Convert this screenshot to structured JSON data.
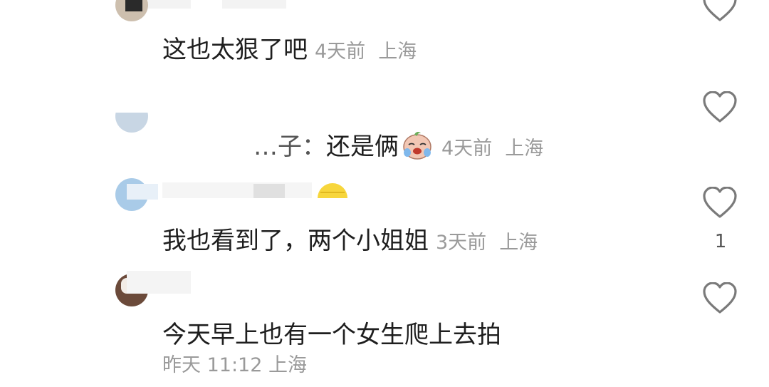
{
  "comments": [
    {
      "text": "这也太狠了吧",
      "time": "4天前",
      "location": "上海",
      "likes": ""
    },
    {
      "reply_prefix": "…子：",
      "text": "还是俩",
      "emoji": "crying-laughing-face-emoji",
      "time": "4天前",
      "location": "上海",
      "likes": ""
    },
    {
      "text": "我也看到了，两个小姐姐",
      "time": "3天前",
      "location": "上海",
      "likes": "1"
    },
    {
      "text": "今天早上也有一个女生爬上去拍",
      "time": "昨天 11:12",
      "location": "上海",
      "likes": ""
    }
  ],
  "icons": {
    "like": "heart-outline-icon"
  },
  "colors": {
    "meta_text": "#9a9a9a",
    "icon_stroke": "#7a7a7a"
  }
}
